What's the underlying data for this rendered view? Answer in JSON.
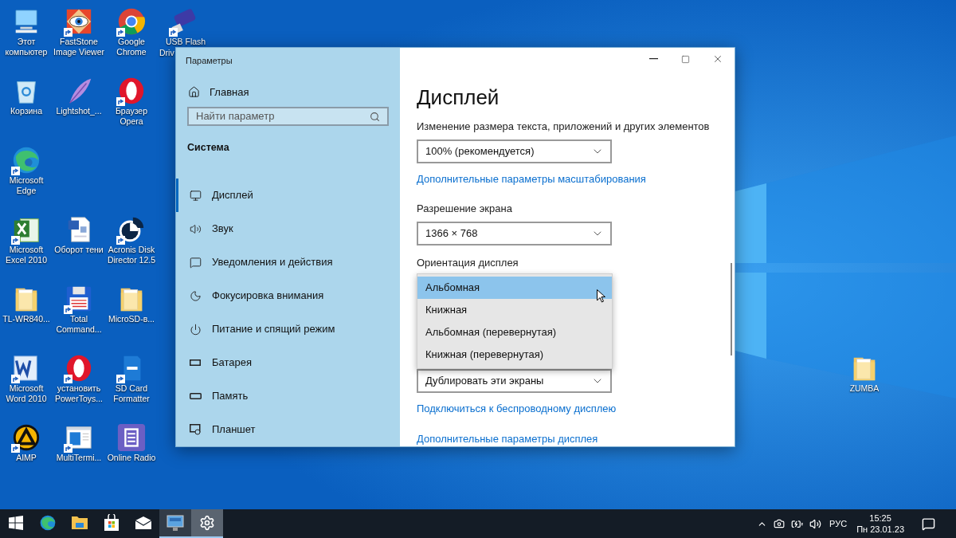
{
  "desktop_icons": [
    {
      "kind": "computer",
      "lines": [
        "Этот",
        "компьютер"
      ],
      "shortcut": false
    },
    {
      "kind": "eye",
      "lines": [
        "FastStone",
        "Image Viewer"
      ],
      "shortcut": true
    },
    {
      "kind": "chrome",
      "lines": [
        "Google",
        "Chrome"
      ],
      "shortcut": true
    },
    {
      "kind": "usb",
      "lines": [
        "USB Flash",
        "Driv"
      ],
      "shortcut": true
    },
    {
      "kind": "recycle",
      "lines": [
        "Корзина"
      ],
      "shortcut": false
    },
    {
      "kind": "feather",
      "lines": [
        "Lightshot_..."
      ],
      "shortcut": false
    },
    {
      "kind": "opera",
      "lines": [
        "Браузер",
        "Opera"
      ],
      "shortcut": true
    },
    {
      "kind": "edge",
      "lines": [
        "Microsoft",
        "Edge"
      ],
      "shortcut": true
    },
    {
      "kind": "excel",
      "lines": [
        "Microsoft",
        "Excel 2010"
      ],
      "shortcut": true
    },
    {
      "kind": "worddoc",
      "lines": [
        "Оборот тени"
      ],
      "shortcut": false
    },
    {
      "kind": "disk",
      "lines": [
        "Acronis Disk",
        "Director 12.5"
      ],
      "shortcut": true
    },
    {
      "kind": "folder",
      "lines": [
        "TL-WR840..."
      ],
      "shortcut": false
    },
    {
      "kind": "floppy",
      "lines": [
        "Total",
        "Command..."
      ],
      "shortcut": true
    },
    {
      "kind": "folder",
      "lines": [
        "MicroSD-в..."
      ],
      "shortcut": false
    },
    {
      "kind": "word",
      "lines": [
        "Microsoft",
        "Word 2010"
      ],
      "shortcut": true
    },
    {
      "kind": "opera",
      "lines": [
        "установить",
        "PowerToys..."
      ],
      "shortcut": true
    },
    {
      "kind": "sd",
      "lines": [
        "SD Card",
        "Formatter"
      ],
      "shortcut": true
    },
    {
      "kind": "aimp",
      "lines": [
        "AIMP"
      ],
      "shortcut": true
    },
    {
      "kind": "terminal",
      "lines": [
        "MultiTermi..."
      ],
      "shortcut": true
    },
    {
      "kind": "radio",
      "lines": [
        "Online Radio"
      ],
      "shortcut": false
    },
    {
      "kind": "folder",
      "lines": [
        "ZUMBA"
      ],
      "shortcut": false
    }
  ],
  "settings_window": {
    "title": "Параметры",
    "nav": {
      "home": "Главная",
      "search_placeholder": "Найти параметр",
      "section": "Система",
      "items": [
        {
          "label": "Дисплей",
          "kind": "monitor",
          "selected": true
        },
        {
          "label": "Звук",
          "kind": "sound",
          "selected": false
        },
        {
          "label": "Уведомления и действия",
          "kind": "notify",
          "selected": false
        },
        {
          "label": "Фокусировка внимания",
          "kind": "moon",
          "selected": false
        },
        {
          "label": "Питание и спящий режим",
          "kind": "power",
          "selected": false
        },
        {
          "label": "Батарея",
          "kind": "battery",
          "selected": false
        },
        {
          "label": "Память",
          "kind": "storage",
          "selected": false
        },
        {
          "label": "Планшет",
          "kind": "tablet",
          "selected": false
        }
      ]
    },
    "page": {
      "title": "Дисплей",
      "scale_label": "Изменение размера текста, приложений и других элементов",
      "scale_value": "100% (рекомендуется)",
      "scale_link": "Дополнительные параметры масштабирования",
      "resolution_label": "Разрешение экрана",
      "resolution_value": "1366 × 768",
      "orientation_label": "Ориентация дисплея",
      "orientation_options": [
        {
          "label": "Альбомная",
          "selected": true
        },
        {
          "label": "Книжная",
          "selected": false
        },
        {
          "label": "Альбомная (перевернутая)",
          "selected": false
        },
        {
          "label": "Книжная (перевернутая)",
          "selected": false
        }
      ],
      "multi_value": "Дублировать эти экраны",
      "links": [
        "Подключиться к беспроводному дисплею",
        "Дополнительные параметры дисплея"
      ]
    }
  },
  "taskbar": {
    "apps": [
      {
        "kind": "start",
        "open": false,
        "selected": false
      },
      {
        "kind": "edge",
        "open": false,
        "selected": false
      },
      {
        "kind": "explorer",
        "open": false,
        "selected": false
      },
      {
        "kind": "store",
        "open": false,
        "selected": false
      },
      {
        "kind": "mail",
        "open": false,
        "selected": false
      },
      {
        "kind": "remote",
        "open": true,
        "selected": false
      },
      {
        "kind": "settings",
        "open": true,
        "selected": true
      }
    ],
    "language": "РУС",
    "time": "15:25",
    "date": "Пн 23.01.23"
  }
}
